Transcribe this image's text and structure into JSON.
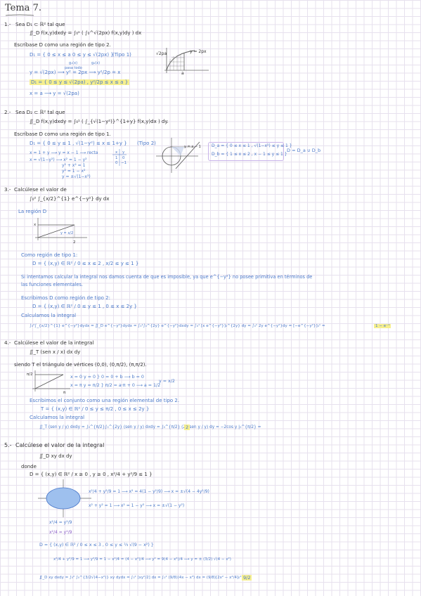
{
  "title": "Tema 7.",
  "p1": {
    "num": "1.-",
    "stmt": "Sea D₁ ⊂ ℝ² tal que",
    "integral": "∬_D f(x,y)dxdy = ∫₀ᵃ ( ∫₀^√(2px) f(x,y)dy ) dx",
    "task": "Escríbase D como una región de tipo 2.",
    "d1": "D₁ = { 0 ≤ x ≤ a    0 ≤ y ≤ √(2px) }",
    "tipo": "(Tipo 1)",
    "g1": "g₁(x)",
    "g2": "g₂(x)",
    "side_note": "pasa todo",
    "eq1": "y = √(2px)  ⟶  y² = 2px  ⟶  y²/2p = x",
    "result": "D₁ = { 0 ≤ y ≤ √(2pa) ,  y²/2p ≤ x ≤ a }",
    "eq2": "x = a  ⟶ y = √(2pa)",
    "graph_ylabel": "√2pa",
    "graph_curve": "y = 2px",
    "graph_a": "a"
  },
  "p2": {
    "num": "2.-",
    "stmt": "Sea D₂ ⊂ ℝ² tal que",
    "integral": "∬_D f(x,y)dxdy = ∫₀¹ ( ∫_{√(1−y²)}^{1+y} f(x,y)dx ) dy.",
    "task": "Escríbase D como una región de tipo 1.",
    "d1": "D₁ = { 0 ≤ y ≤ 1 ,   √(1−y²) ≤ x ≤ 1+y }",
    "tipo": "(Tipo 2)",
    "lines": [
      "x = 1 + y  ⟶ y = x − 1 ⟶ recta",
      "x = √(1−y²) ⟶ x² = 1 − y²",
      "y² + x² = 1",
      "y² = 1 − x²",
      "y = ±√(1−x²)"
    ],
    "table_head": [
      "x",
      "y"
    ],
    "table_rows": [
      [
        "1",
        "0"
      ],
      [
        "0",
        "−1"
      ]
    ],
    "graph_label": "y = x − 1",
    "res_a": "D_a = { 0 ≤ x ≤ 1 , √(1−x²) ≤ y ≤ 1 }",
    "res_b": "D_b = { 1 ≤ x ≤ 2 , x − 1 ≤ y ≤ 1 }",
    "union": "D = D_a ∪ D_b"
  },
  "p3": {
    "num": "3.-",
    "stmt": "Calcúlese el valor de",
    "integral": "∫₀² ∫_{x/2}^{1} e^{−y²} dy dx",
    "region": "La región D",
    "graph_x": "x",
    "graph_line": "y = x/2",
    "graph_2": "2",
    "tipo1": "Como región de tipo 1:",
    "d1": "D = { (x,y) ∈ ℝ² / 0 ≤ x ≤ 2 ,  x/2 ≤ y ≤ 1 }",
    "txt1": "Si intentamos calcular la integral nos damos cuenta de que es imposible, ya que  e^{−y²} no posee primitiva en términos de",
    "txt2": "las funciones elementales.",
    "tipo2": "Escribimos D como región de tipo 2:",
    "d2": "D = { (x,y) ∈ ℝ² / 0 ≤ y ≤ 1 ,  0 ≤ x ≤ 2y }",
    "calc": "Calculamos la integral",
    "final": "∫₀²∫_{x/2}^{1} e^{−y²}dydx = ∬_D e^{−y²}dydx = ∫₀¹∫₀^{2y} e^{−y²}dxdy = ∫₀¹ [x e^{−y²}]₀^{2y} dy = ∫₀¹ 2y e^{−y²}dy = [−e^{−y²}]₀¹ =",
    "answer": "1 − e⁻¹"
  },
  "p4": {
    "num": "4.-",
    "stmt": "Calcúlese el valor de la integral",
    "integral": "∬_T (sen x / x) dx dy",
    "triangle": "siendo T el triángulo de vértices (0,0), (0,π/2), (π,π/2).",
    "graph_y": "π/2",
    "graph_x": "π",
    "sys1": "x = 0    y = 0  }  0 = 0 + b ⟶ b = 0",
    "sys2": "x = π    y = π/2  }  π/2 = a·π + 0 ⟶ a = 1/2",
    "sys_res": "y = x/2",
    "desc": "Escribimos el conjunto como una región elemental de tipo 2.",
    "set": "T = { (x,y) ∈ ℝ² / 0 ≤ y ≤ π/2 ,  0 ≤ x ≤ 2y }",
    "calc": "Calculamos la integral",
    "final": "∬_T (sen y / y) dxdy = ∫₀^{π/2}∫₀^{2y} (sen y / y) dxdy = ∫₀^{π/2} (2y sen y / y) dy = −2cos y |₀^{π/2} =",
    "answer": "2"
  },
  "p5": {
    "num": "5.-",
    "stmt": "Calcúlese el valor de la integral",
    "integral": "∬_D xy dx dy",
    "donde": "donde",
    "set": "D = { (x,y) ∈ ℝ² / x ≥ 0 ,  y ≥ 0 ,  x²/4 + y²/9 ≤ 1 }",
    "e1": "x²/4 + y²/9 = 1  ⟶  x² = 4(1 − y²/9)  ⟶  x = ±√(4 − 4y²/9)",
    "e2": "x² + y² = 1  ⟶  x² = 1 − y²  ⟶  x = ±√(1 − y²)",
    "e3a": "x²/4 = y²/9",
    "e3b": "x²/4 = y²/9",
    "d": "D = { (x,y) ∈ ℝ² / 0 ≤ x ≤ 3 ,  0 ≤ y ≤ ⅔ √(9 − x²) }",
    "e4": "x²/4 + y²/9 = 1  ⟶  y²/9 = 1 − x²/4 = (4 − x²)/4  ⟶  y² = 9(4 − x²)/4  ⟶  y = ± (3/2) √(4 − x²)",
    "final": "∬_D xy dxdy = ∫₀² ∫₀^{3/2√(4−x²)} xy dydx = ∫₀² [xy²/2] dx = ∫₀² (9/8)(4x − x³) dx = (9/8)[2x² − x⁴/4]₀² =",
    "answer": "9/2"
  }
}
